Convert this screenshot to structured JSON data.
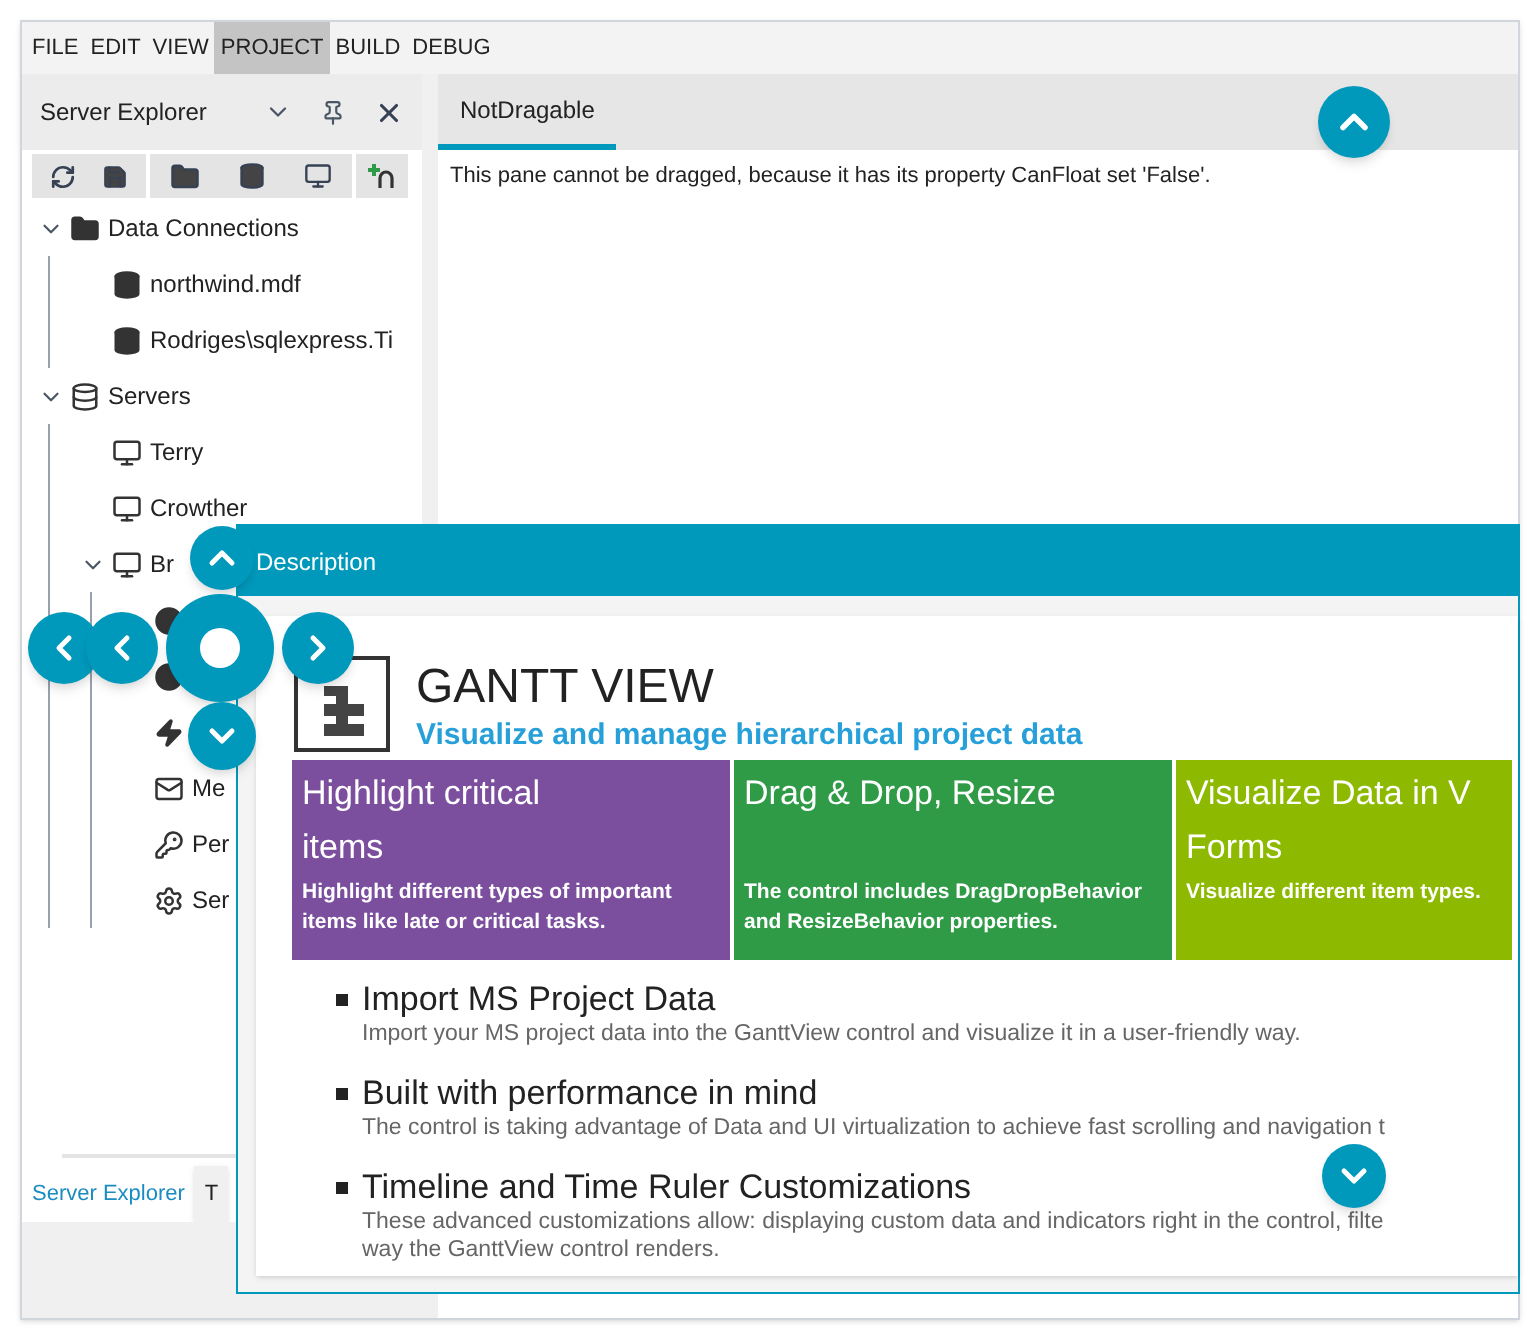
{
  "menu": [
    {
      "label": "FILE",
      "selected": false
    },
    {
      "label": "EDIT",
      "selected": false
    },
    {
      "label": "VIEW",
      "selected": false
    },
    {
      "label": "PROJECT",
      "selected": true
    },
    {
      "label": "BUILD",
      "selected": false
    },
    {
      "label": "DEBUG",
      "selected": false
    }
  ],
  "server_explorer": {
    "title": "Server Explorer",
    "tree": [
      {
        "label": "Data Connections",
        "kind": "folder",
        "expanded": true,
        "children": [
          {
            "label": "northwind.mdf",
            "kind": "database"
          },
          {
            "label": "Rodriges\\sqlexpress.Ti",
            "kind": "database"
          }
        ]
      },
      {
        "label": "Servers",
        "kind": "servers",
        "expanded": true,
        "children": [
          {
            "label": "Terry",
            "kind": "computer"
          },
          {
            "label": "Crowther",
            "kind": "computer"
          },
          {
            "label": "Br",
            "kind": "computer",
            "expanded": true,
            "children": [
              {
                "kind": "node"
              },
              {
                "kind": "node"
              },
              {
                "kind": "lightning"
              },
              {
                "label": "Me",
                "kind": "mail"
              },
              {
                "label": "Per",
                "kind": "key"
              },
              {
                "label": "Ser",
                "kind": "gear"
              }
            ]
          }
        ]
      }
    ],
    "tabs": [
      {
        "label": "Server Explorer",
        "selected": true
      },
      {
        "label": "T",
        "selected": false
      }
    ]
  },
  "document": {
    "tabs": [
      {
        "label": "NotDragable",
        "selected": true
      }
    ],
    "text": "This pane cannot be dragged, because it has its property CanFloat set 'False'."
  },
  "floating_window": {
    "title": "Description",
    "heading": "GANTT VIEW",
    "subtitle": "Visualize and manage hierarchical project data",
    "tiles": [
      {
        "title": "Highlight critical\nitems",
        "text": "Highlight different types of important items like late or critical tasks.",
        "color": "#7b4f9e"
      },
      {
        "title": "Drag & Drop, Resize",
        "text": "The control includes DragDropBehavior and ResizeBehavior properties.",
        "color": "#2f9b47"
      },
      {
        "title": "Visualize Data in V\nForms",
        "text": "Visualize different item types.",
        "color": "#8dba00"
      }
    ],
    "features": [
      {
        "title": "Import MS Project Data",
        "text": "Import your MS project data into the GanttView control and visualize it in a user-friendly way."
      },
      {
        "title": "Built with performance in mind",
        "text": "The control is taking advantage of Data and UI virtualization to achieve fast scrolling and navigation t"
      },
      {
        "title": "Timeline and Time Ruler Customizations",
        "text": "These advanced customizations allow: displaying custom data and indicators right in the control, filte\nway the GanttView control renders."
      }
    ]
  }
}
